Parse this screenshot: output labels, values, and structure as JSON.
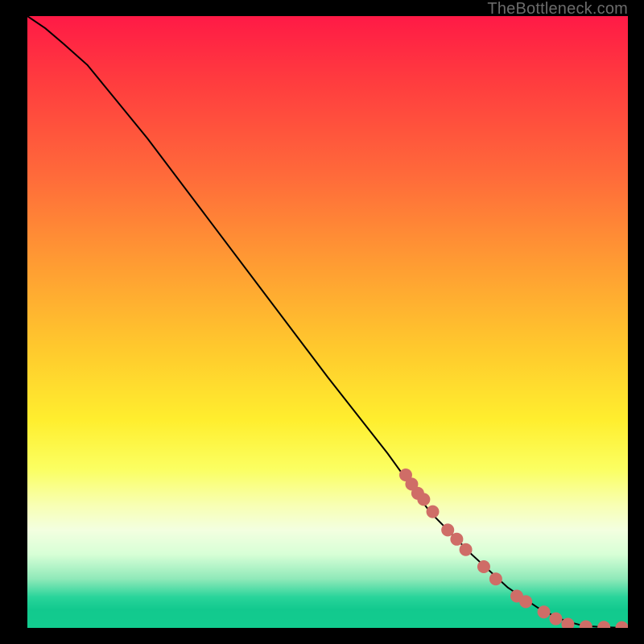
{
  "watermark": "TheBottleneck.com",
  "colors": {
    "curve": "#000000",
    "marker_fill": "#cf6d67",
    "marker_stroke": "#cf6d67"
  },
  "chart_data": {
    "type": "line",
    "title": "",
    "xlabel": "",
    "ylabel": "",
    "xlim": [
      0,
      100
    ],
    "ylim": [
      0,
      100
    ],
    "grid": false,
    "series": [
      {
        "name": "curve",
        "x": [
          0,
          3,
          6,
          10,
          15,
          20,
          30,
          40,
          50,
          60,
          67,
          74,
          80,
          85,
          88,
          90,
          92,
          94,
          96,
          98,
          100
        ],
        "y": [
          100,
          98,
          95.5,
          92,
          86,
          80,
          67,
          54,
          41,
          28.5,
          19,
          12,
          6.6,
          3.3,
          1.8,
          1.0,
          0.5,
          0.25,
          0.12,
          0.05,
          0.0
        ]
      }
    ],
    "markers": [
      {
        "x": 63.0,
        "y": 25.0
      },
      {
        "x": 64.0,
        "y": 23.5
      },
      {
        "x": 65.0,
        "y": 22.0
      },
      {
        "x": 66.0,
        "y": 21.0
      },
      {
        "x": 67.5,
        "y": 19.0
      },
      {
        "x": 70.0,
        "y": 16.0
      },
      {
        "x": 71.5,
        "y": 14.5
      },
      {
        "x": 73.0,
        "y": 12.8
      },
      {
        "x": 76.0,
        "y": 10.0
      },
      {
        "x": 78.0,
        "y": 8.0
      },
      {
        "x": 81.5,
        "y": 5.2
      },
      {
        "x": 83.0,
        "y": 4.3
      },
      {
        "x": 86.0,
        "y": 2.6
      },
      {
        "x": 88.0,
        "y": 1.5
      },
      {
        "x": 90.0,
        "y": 0.6
      },
      {
        "x": 93.0,
        "y": 0.2
      },
      {
        "x": 96.0,
        "y": 0.1
      },
      {
        "x": 99.0,
        "y": 0.05
      }
    ]
  }
}
